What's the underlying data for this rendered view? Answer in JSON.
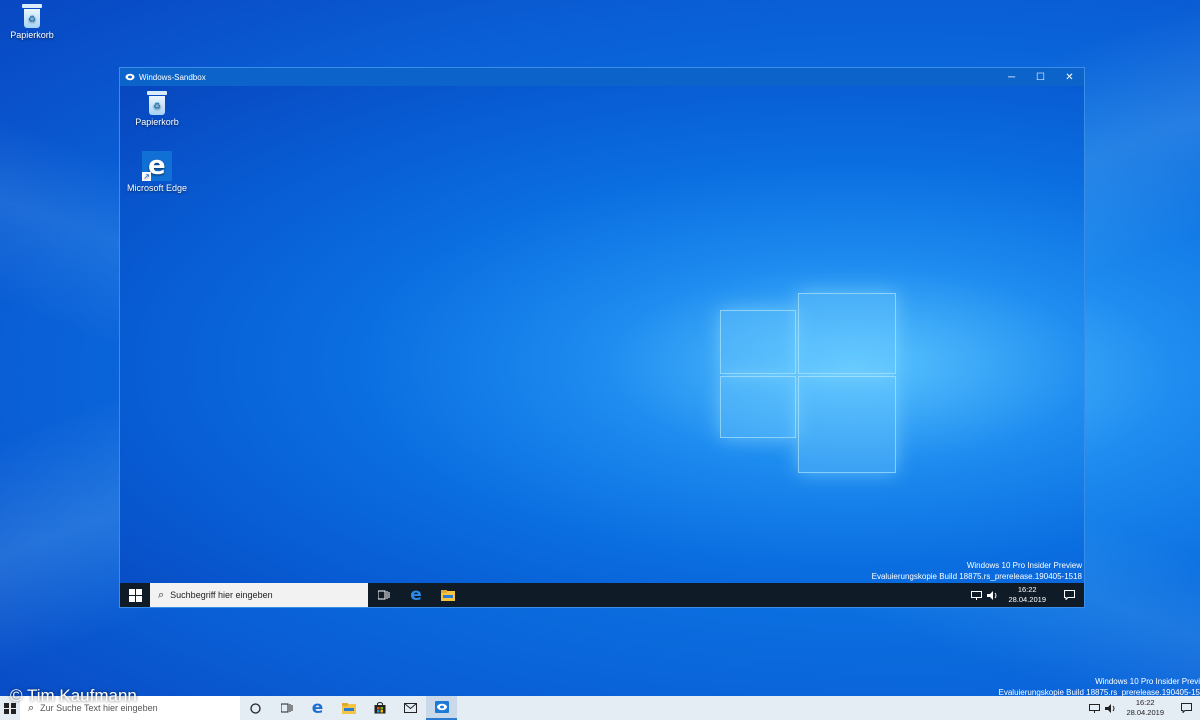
{
  "desktop": {
    "icons": [
      {
        "label": "Papierkorb",
        "icon": "recycle-bin-icon"
      }
    ],
    "watermark_line1": "Windows 10 Pro Insider Previ",
    "watermark_line2": "Evaluierungskopie Build 18875.rs_prerelease.190405-15"
  },
  "sandbox": {
    "title": "Windows-Sandbox",
    "controls": {
      "minimize": "─",
      "maximize": "☐",
      "close": "✕"
    },
    "icons": [
      {
        "label": "Papierkorb",
        "icon": "recycle-bin-icon"
      },
      {
        "label": "Microsoft Edge",
        "icon": "edge-icon"
      }
    ],
    "watermark_line1": "Windows 10 Pro Insider Preview",
    "watermark_line2": "Evaluierungskopie Build 18875.rs_prerelease.190405-1518",
    "taskbar": {
      "search_placeholder": "Suchbegriff hier eingeben",
      "time": "16:22",
      "date": "28.04.2019"
    }
  },
  "host_taskbar": {
    "search_placeholder": "Zur Suche Text hier eingeben",
    "time": "16:22",
    "date": "28.04.2019"
  },
  "credit": "© Tim Kaufmann",
  "colors": {
    "accent": "#0a6ee0",
    "taskbar_dark": "#0f1b27",
    "taskbar_light": "#e4ecf4"
  }
}
